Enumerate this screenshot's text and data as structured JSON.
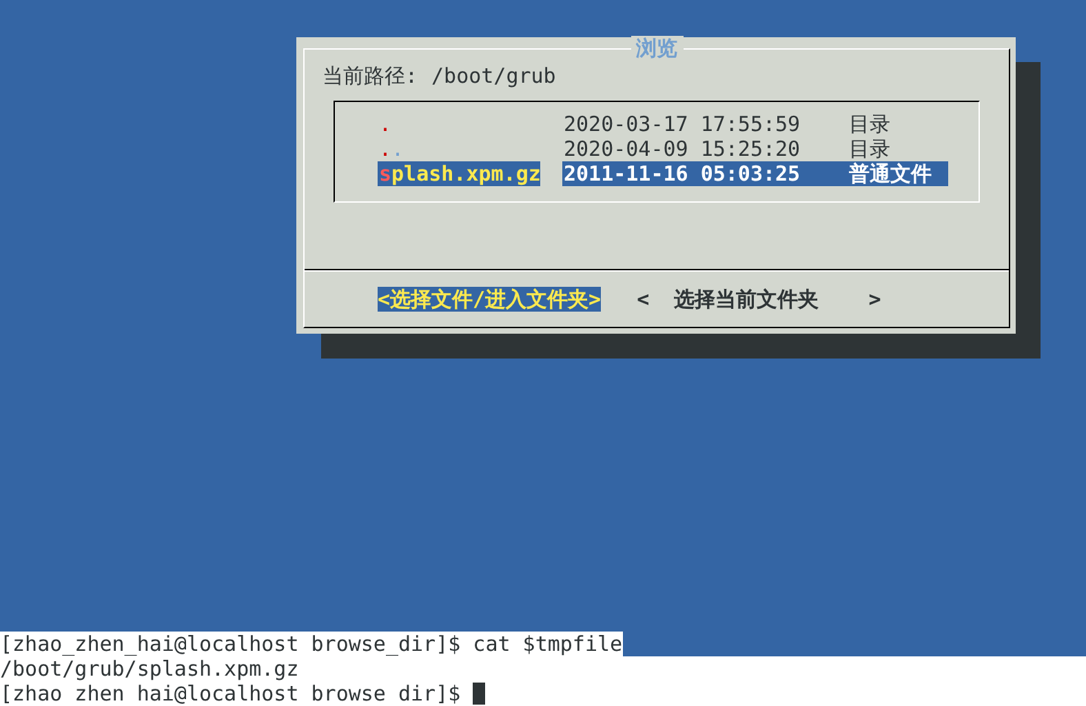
{
  "dialog": {
    "title": "浏览",
    "path_label": "当前路径:",
    "path": "/boot/grub",
    "files": [
      {
        "name": ".",
        "modified": "2020-03-17 17:55:59",
        "type": "目录",
        "selected": false
      },
      {
        "name": "..",
        "modified": "2020-04-09 15:25:20",
        "type": "目录",
        "selected": false
      },
      {
        "name": "splash.xpm.gz",
        "modified": "2011-11-16 05:03:25",
        "type": "普通文件",
        "selected": true
      }
    ],
    "buttons": [
      {
        "label": "<选择文件/进入文件夹>",
        "selected": true
      },
      {
        "label": "<  选择当前文件夹    >",
        "selected": false
      }
    ]
  },
  "terminal": {
    "lines": [
      {
        "text": "[zhao_zhen_hai@localhost browse_dir]$ cat $tmpfile",
        "cursor": false
      },
      {
        "text": "/boot/grub/splash.xpm.gz",
        "cursor": false
      },
      {
        "text": "[zhao zhen hai@localhost browse dir]$ ",
        "cursor": true
      }
    ]
  }
}
